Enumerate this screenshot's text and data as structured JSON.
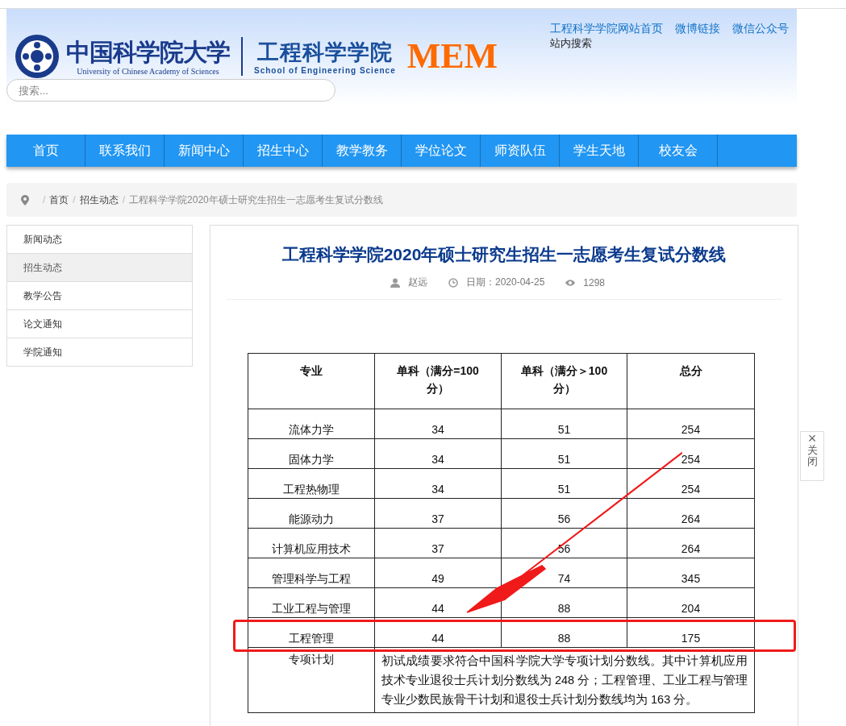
{
  "header": {
    "cn_name": "中国科学院大学",
    "en_name": "University of Chinese Academy of Sciences",
    "school_cn": "工程科学学院",
    "school_en": "School of Engineering Science",
    "brand": "MEM",
    "top_links": [
      "工程科学学院网站首页",
      "微博链接",
      "微信公众号"
    ],
    "search_label": "站内搜索",
    "search": {
      "placeholder": "搜索..."
    }
  },
  "nav": [
    "首页",
    "联系我们",
    "新闻中心",
    "招生中心",
    "教学教务",
    "学位论文",
    "师资队伍",
    "学生天地",
    "校友会"
  ],
  "breadcrumb": {
    "separator": "/",
    "items": [
      "首页",
      "招生动态",
      "工程科学学院2020年硕士研究生招生一志愿考生复试分数线"
    ]
  },
  "sidebar": [
    {
      "label": "新闻动态",
      "selected": false
    },
    {
      "label": "招生动态",
      "selected": true
    },
    {
      "label": "教学公告",
      "selected": false
    },
    {
      "label": "论文通知",
      "selected": false
    },
    {
      "label": "学院通知",
      "selected": false
    }
  ],
  "article": {
    "title": "工程科学学院2020年硕士研究生招生一志愿考生复试分数线",
    "author": "赵远",
    "date": "日期：2020-04-25",
    "views": "1298",
    "table": {
      "columns": [
        "专业",
        "单科（满分=100 分）",
        "单科（满分＞100 分）",
        "总分"
      ],
      "rows": [
        {
          "cells": [
            "流体力学",
            "34",
            "51",
            "254"
          ],
          "highlighted": false
        },
        {
          "cells": [
            "固体力学",
            "34",
            "51",
            "254"
          ],
          "highlighted": false
        },
        {
          "cells": [
            "工程热物理",
            "34",
            "51",
            "254"
          ],
          "highlighted": false
        },
        {
          "cells": [
            "能源动力",
            "37",
            "56",
            "264"
          ],
          "highlighted": false
        },
        {
          "cells": [
            "计算机应用技术",
            "37",
            "56",
            "264"
          ],
          "highlighted": false
        },
        {
          "cells": [
            "管理科学与工程",
            "49",
            "74",
            "345"
          ],
          "highlighted": false
        },
        {
          "cells": [
            "工业工程与管理",
            "44",
            "88",
            "204"
          ],
          "highlighted": false
        },
        {
          "cells": [
            "工程管理",
            "44",
            "88",
            "175"
          ],
          "highlighted": true
        }
      ],
      "note": {
        "label": "专项计划",
        "text": "初试成绩要求符合中国科学院大学专项计划分数线。其中计算机应用技术专业退役士兵计划分数线为 248 分；工程管理、工业工程与管理专业少数民族骨干计划和退役士兵计划分数线均为 163 分。"
      }
    }
  },
  "float_close": {
    "symbol": "×",
    "label": "关闭"
  }
}
